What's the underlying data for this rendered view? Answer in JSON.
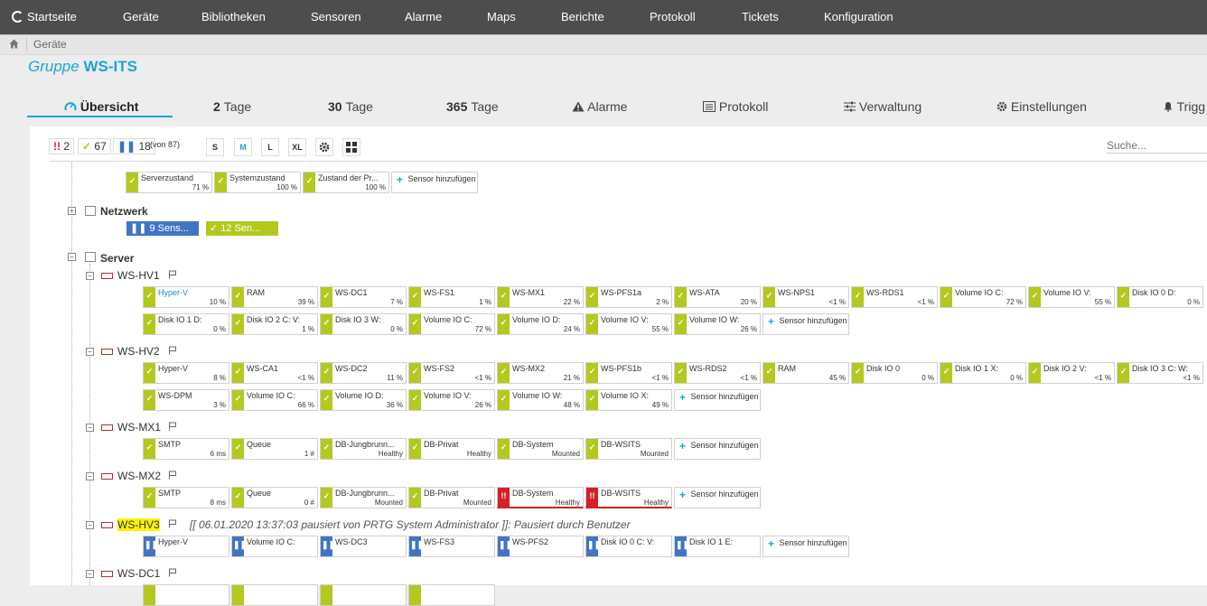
{
  "nav": {
    "home": "Startseite",
    "items": [
      "Geräte",
      "Bibliotheken",
      "Sensoren",
      "Alarme",
      "Maps",
      "Berichte",
      "Protokoll",
      "Tickets",
      "Konfiguration"
    ]
  },
  "breadcrumb": {
    "item": "Geräte"
  },
  "title": {
    "prefix": "Gruppe",
    "name": "WS-ITS"
  },
  "tabs": [
    {
      "label": "Übersicht"
    },
    {
      "num": "2",
      "label": "Tage"
    },
    {
      "num": "30",
      "label": "Tage"
    },
    {
      "num": "365",
      "label": "Tage"
    },
    {
      "label": "Alarme"
    },
    {
      "label": "Protokoll"
    },
    {
      "label": "Verwaltung"
    },
    {
      "label": "Einstellungen"
    },
    {
      "label": "Trigg"
    }
  ],
  "toolbar": {
    "down_count": "2",
    "up_count": "67",
    "paused_count": "18",
    "total": "(von 87)",
    "sizes": [
      "S",
      "M",
      "L",
      "XL"
    ],
    "search_placeholder": "Suche..."
  },
  "colors": {
    "ok": "#b4c81e",
    "paused": "#4274c4",
    "down": "#d61f27",
    "accent": "#1fa3d7"
  },
  "root_sensors": [
    {
      "name": "Serverzustand",
      "value": "71 %",
      "status": "ok"
    },
    {
      "name": "Systemzustand",
      "value": "100 %",
      "status": "ok"
    },
    {
      "name": "Zustand der Pr...",
      "value": "100 %",
      "status": "ok"
    }
  ],
  "add_sensor": "Sensor hinzufügen",
  "groups": {
    "netzwerk": {
      "name": "Netzwerk",
      "paused_btn": "9 Sens...",
      "ok_btn": "12 Sen..."
    },
    "server": {
      "name": "Server"
    }
  },
  "devices": [
    {
      "name": "WS-HV1",
      "sensors": [
        {
          "name": "Hyper-V",
          "value": "10 %",
          "status": "ok",
          "link": true
        },
        {
          "name": "RAM",
          "value": "39 %",
          "status": "ok"
        },
        {
          "name": "WS-DC1",
          "value": "7 %",
          "status": "ok"
        },
        {
          "name": "WS-FS1",
          "value": "1 %",
          "status": "ok"
        },
        {
          "name": "WS-MX1",
          "value": "22 %",
          "status": "ok"
        },
        {
          "name": "WS-PFS1a",
          "value": "2 %",
          "status": "ok"
        },
        {
          "name": "WS-ATA",
          "value": "20 %",
          "status": "ok"
        },
        {
          "name": "WS-NPS1",
          "value": "<1 %",
          "status": "ok"
        },
        {
          "name": "WS-RDS1",
          "value": "<1 %",
          "status": "ok"
        },
        {
          "name": "Volume IO C:",
          "value": "72 %",
          "status": "ok"
        },
        {
          "name": "Volume IO V:",
          "value": "55 %",
          "status": "ok"
        },
        {
          "name": "Disk IO 0 D:",
          "value": "0 %",
          "status": "ok"
        },
        {
          "name": "Disk IO 1 D:",
          "value": "0 %",
          "status": "ok"
        },
        {
          "name": "Disk IO 2 C: V:",
          "value": "1 %",
          "status": "ok"
        },
        {
          "name": "Disk IO 3 W:",
          "value": "0 %",
          "status": "ok"
        },
        {
          "name": "Volume IO C:",
          "value": "72 %",
          "status": "ok"
        },
        {
          "name": "Volume IO D:",
          "value": "24 %",
          "status": "ok"
        },
        {
          "name": "Volume IO V:",
          "value": "55 %",
          "status": "ok"
        },
        {
          "name": "Volume IO W:",
          "value": "26 %",
          "status": "ok"
        }
      ]
    },
    {
      "name": "WS-HV2",
      "sensors": [
        {
          "name": "Hyper-V",
          "value": "8 %",
          "status": "ok"
        },
        {
          "name": "WS-CA1",
          "value": "<1 %",
          "status": "ok"
        },
        {
          "name": "WS-DC2",
          "value": "11 %",
          "status": "ok"
        },
        {
          "name": "WS-FS2",
          "value": "<1 %",
          "status": "ok"
        },
        {
          "name": "WS-MX2",
          "value": "21 %",
          "status": "ok"
        },
        {
          "name": "WS-PFS1b",
          "value": "<1 %",
          "status": "ok"
        },
        {
          "name": "WS-RDS2",
          "value": "<1 %",
          "status": "ok"
        },
        {
          "name": "RAM",
          "value": "45 %",
          "status": "ok"
        },
        {
          "name": "Disk IO 0",
          "value": "0 %",
          "status": "ok"
        },
        {
          "name": "Disk IO 1 X:",
          "value": "0 %",
          "status": "ok"
        },
        {
          "name": "Disk IO 2 V:",
          "value": "<1 %",
          "status": "ok"
        },
        {
          "name": "Disk IO 3 C: W:",
          "value": "<1 %",
          "status": "ok"
        },
        {
          "name": "WS-DPM",
          "value": "3 %",
          "status": "ok"
        },
        {
          "name": "Volume IO C:",
          "value": "66 %",
          "status": "ok"
        },
        {
          "name": "Volume IO D:",
          "value": "36 %",
          "status": "ok"
        },
        {
          "name": "Volume IO V:",
          "value": "26 %",
          "status": "ok"
        },
        {
          "name": "Volume IO W:",
          "value": "48 %",
          "status": "ok"
        },
        {
          "name": "Volume IO X:",
          "value": "49 %",
          "status": "ok"
        }
      ]
    },
    {
      "name": "WS-MX1",
      "sensors": [
        {
          "name": "SMTP",
          "value": "6 ms",
          "status": "ok"
        },
        {
          "name": "Queue",
          "value": "1 #",
          "status": "ok"
        },
        {
          "name": "DB-Jungbrunn...",
          "value": "Healthy",
          "status": "ok"
        },
        {
          "name": "DB-Privat",
          "value": "Healthy",
          "status": "ok"
        },
        {
          "name": "DB-System",
          "value": "Mounted",
          "status": "ok"
        },
        {
          "name": "DB-WSITS",
          "value": "Mounted",
          "status": "ok"
        }
      ]
    },
    {
      "name": "WS-MX2",
      "sensors": [
        {
          "name": "SMTP",
          "value": "8 ms",
          "status": "ok"
        },
        {
          "name": "Queue",
          "value": "0 #",
          "status": "ok"
        },
        {
          "name": "DB-Jungbrunn...",
          "value": "Mounted",
          "status": "ok"
        },
        {
          "name": "DB-Privat",
          "value": "Mounted",
          "status": "ok"
        },
        {
          "name": "DB-System",
          "value": "Healthy",
          "status": "down"
        },
        {
          "name": "DB-WSITS",
          "value": "Healthy",
          "status": "down"
        }
      ]
    },
    {
      "name": "WS-HV3",
      "highlight": true,
      "pause_note": "[[ 06.01.2020 13:37:03 pausiert von PRTG System Administrator ]]: Pausiert durch Benutzer",
      "sensors": [
        {
          "name": "Hyper-V",
          "value": "",
          "status": "paused"
        },
        {
          "name": "Volume IO C:",
          "value": "",
          "status": "paused"
        },
        {
          "name": "WS-DC3",
          "value": "",
          "status": "paused"
        },
        {
          "name": "WS-FS3",
          "value": "",
          "status": "paused"
        },
        {
          "name": "WS-PFS2",
          "value": "",
          "status": "paused"
        },
        {
          "name": "Disk IO 0 C: V:",
          "value": "",
          "status": "paused"
        },
        {
          "name": "Disk IO 1 E:",
          "value": "",
          "status": "paused"
        }
      ]
    },
    {
      "name": "WS-DC1",
      "sensors": []
    }
  ]
}
